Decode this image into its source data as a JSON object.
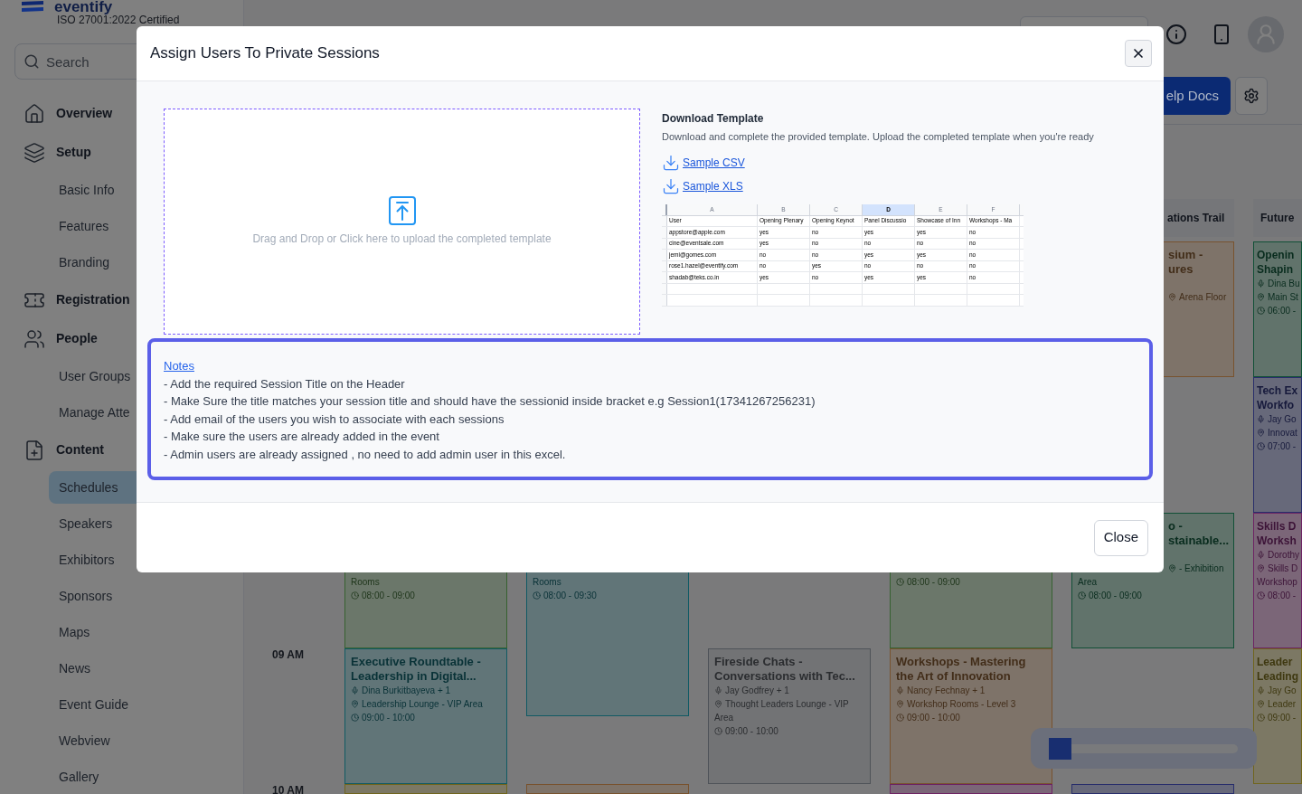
{
  "sidebar": {
    "logo_text": "eventify",
    "certification": "ISO 27001:2022 Certified",
    "search": {
      "placeholder": "Search"
    },
    "nav": [
      {
        "kind": "section",
        "label": "Overview",
        "selected": false
      },
      {
        "kind": "section",
        "label": "Setup",
        "selected": false
      },
      {
        "kind": "sub",
        "label": "Basic Info",
        "selected": false
      },
      {
        "kind": "sub",
        "label": "Features",
        "selected": false
      },
      {
        "kind": "sub",
        "label": "Branding",
        "selected": false
      },
      {
        "kind": "section",
        "label": "Registration",
        "selected": false
      },
      {
        "kind": "section",
        "label": "People",
        "selected": false
      },
      {
        "kind": "sub",
        "label": "User Groups",
        "selected": false
      },
      {
        "kind": "sub",
        "label": "Manage Atte",
        "selected": false
      },
      {
        "kind": "section",
        "label": "Content",
        "selected": false
      },
      {
        "kind": "sub",
        "label": "Schedules",
        "selected": true
      },
      {
        "kind": "sub",
        "label": "Speakers",
        "selected": false
      },
      {
        "kind": "sub",
        "label": "Exhibitors",
        "selected": false
      },
      {
        "kind": "sub",
        "label": "Sponsors",
        "selected": false
      },
      {
        "kind": "sub",
        "label": "Maps",
        "selected": false
      },
      {
        "kind": "sub",
        "label": "News",
        "selected": false
      },
      {
        "kind": "sub",
        "label": "Event Guide",
        "selected": false
      },
      {
        "kind": "sub",
        "label": "Webview",
        "selected": false
      },
      {
        "kind": "sub",
        "label": "Gallery",
        "selected": false
      }
    ]
  },
  "toolbar": {
    "help_button": "elp Docs"
  },
  "schedule": {
    "time_labels": [
      "09 AM",
      "10 AM"
    ],
    "columns": [
      {
        "cards": [
          {
            "color": "#366130",
            "lines": [
              {
                "kind": "wrap",
                "text": "Rooms"
              },
              {
                "kind": "time",
                "text": "08:00 - 09:00"
              }
            ]
          },
          {
            "color": "#105a64",
            "lines": [
              {
                "kind": "title",
                "text": "Executive Roundtable -"
              },
              {
                "kind": "title",
                "text": "Leadership in Digital..."
              },
              {
                "kind": "speaker",
                "text": "Dina Burkitbayeva + 1"
              },
              {
                "kind": "location",
                "text": "Leadership Lounge - VIP Area"
              },
              {
                "kind": "time",
                "text": "09:00 - 10:00"
              }
            ]
          },
          {
            "color": "#70651d"
          }
        ]
      },
      {
        "cards": [
          {
            "color": "#105a64",
            "lines": [
              {
                "kind": "wrap",
                "text": "Rooms"
              },
              {
                "kind": "time",
                "text": "08:00 - 09:30"
              }
            ]
          },
          {
            "color": "#78522e"
          }
        ]
      },
      {
        "cards": [
          {
            "color": "#4e5258",
            "lines": [
              {
                "kind": "title",
                "text": "Fireside Chats -"
              },
              {
                "kind": "title",
                "text": "Conversations with Tec..."
              },
              {
                "kind": "speaker",
                "text": "Jay Godfrey + 1"
              },
              {
                "kind": "location",
                "text": "Thought Leaders Lounge - VIP"
              },
              {
                "kind": "wrap",
                "text": "Area"
              },
              {
                "kind": "time",
                "text": "09:00 - 10:00"
              }
            ]
          }
        ]
      },
      {
        "cards": [
          {
            "color": "#366130",
            "lines": [
              {
                "kind": "time",
                "text": "08:00 - 09:00"
              }
            ]
          },
          {
            "color": "#78522e",
            "lines": [
              {
                "kind": "title",
                "text": "Workshops - Mastering"
              },
              {
                "kind": "title",
                "text": "the Art of Innovation"
              },
              {
                "kind": "speaker",
                "text": "Nancy Fechnay + 1"
              },
              {
                "kind": "location",
                "text": "Workshop Rooms - Level 3"
              },
              {
                "kind": "time",
                "text": "09:00 - 10:00"
              }
            ]
          },
          {
            "color": "#6d2364"
          }
        ]
      },
      {
        "header": "ations Trail",
        "cards": [
          {
            "color": "#78522e",
            "lines": [
              {
                "kind": "title",
                "text": "sium -"
              },
              {
                "kind": "title",
                "text": "ures"
              },
              {
                "kind": "location",
                "text": "Arena Floor"
              }
            ]
          },
          {
            "color": "#115036",
            "lines": [
              {
                "kind": "title",
                "text": "o -"
              },
              {
                "kind": "title",
                "text": "stainable..."
              },
              {
                "kind": "location",
                "text": "- Exhibition"
              },
              {
                "kind": "wrap",
                "text": "Area"
              },
              {
                "kind": "time",
                "text": "08:00 - 09:00"
              }
            ]
          },
          {
            "color": "#282e6b"
          }
        ]
      },
      {
        "header": "Future",
        "cards": [
          {
            "color": "#115036",
            "lines": [
              {
                "kind": "title",
                "text": "Openin"
              },
              {
                "kind": "title",
                "text": "Shapin"
              },
              {
                "kind": "speaker",
                "text": "Dina Bu"
              },
              {
                "kind": "location",
                "text": "Main St"
              },
              {
                "kind": "time",
                "text": "06:00 -"
              }
            ]
          },
          {
            "color": "#282e6b",
            "lines": [
              {
                "kind": "title",
                "text": "Tech Ex"
              },
              {
                "kind": "title",
                "text": "Workfo"
              },
              {
                "kind": "speaker",
                "text": "Jay Go"
              },
              {
                "kind": "location",
                "text": "Innovat"
              },
              {
                "kind": "time",
                "text": "07:00 -"
              }
            ]
          },
          {
            "color": "#6d2364",
            "lines": [
              {
                "kind": "title",
                "text": "Skills D"
              },
              {
                "kind": "title",
                "text": "Worksh"
              },
              {
                "kind": "speaker",
                "text": "Dorothy"
              },
              {
                "kind": "location",
                "text": "Skills D"
              },
              {
                "kind": "wrap",
                "text": "Workshop"
              },
              {
                "kind": "time",
                "text": "08:00 -"
              }
            ]
          },
          {
            "color": "#70651d",
            "lines": [
              {
                "kind": "title",
                "text": "Leader"
              },
              {
                "kind": "title",
                "text": "Leading"
              },
              {
                "kind": "speaker",
                "text": "Jay Go"
              },
              {
                "kind": "location",
                "text": "Leader"
              },
              {
                "kind": "time",
                "text": "09:00 -"
              }
            ]
          }
        ]
      }
    ],
    "scroll_slider": {
      "level": 0.12
    }
  },
  "modal": {
    "title": "Assign Users To Private Sessions",
    "dropzone": {
      "text": "Drag and Drop or Click here to upload the completed template"
    },
    "download": {
      "title": "Download Template",
      "description": "Download and complete the provided template. Upload the completed template when you're ready",
      "links": [
        "Sample CSV",
        "Sample XLS"
      ]
    },
    "template_preview": {
      "column_letters": [
        {
          "label": "A",
          "selected": false
        },
        {
          "label": "B",
          "selected": false
        },
        {
          "label": "C",
          "selected": false
        },
        {
          "label": "D",
          "selected": true
        },
        {
          "label": "E",
          "selected": false
        },
        {
          "label": "F",
          "selected": false
        }
      ],
      "rows": [
        [
          "User",
          "Opening Plenary",
          "Opening Keynot",
          "Panel Discussio",
          "Showcase of Inn",
          "Workshops - Ma"
        ],
        [
          "appstore@apple.com",
          "yes",
          "no",
          "yes",
          "yes",
          "no"
        ],
        [
          "cine@eventsale.com",
          "yes",
          "no",
          "no",
          "no",
          "no"
        ],
        [
          "jemi@gomes.com",
          "no",
          "no",
          "yes",
          "yes",
          "no"
        ],
        [
          "rose1.hazel@eventify.com",
          "no",
          "yes",
          "no",
          "no",
          "no"
        ],
        [
          "shadab@teks.co.in",
          "yes",
          "no",
          "yes",
          "yes",
          "no"
        ]
      ]
    },
    "notes": {
      "heading": "Notes",
      "lines": [
        "- Add the required Session Title on the Header",
        "- Make Sure the title matches your session title and should have the sessionid inside bracket e.g Session1(17341267256231)",
        "- Add email of the users you wish to associate with each sessions",
        "- Make sure the users are already added in the event",
        "- Admin users are already assigned , no need to add admin user in this excel."
      ]
    },
    "close_button": "Close"
  }
}
